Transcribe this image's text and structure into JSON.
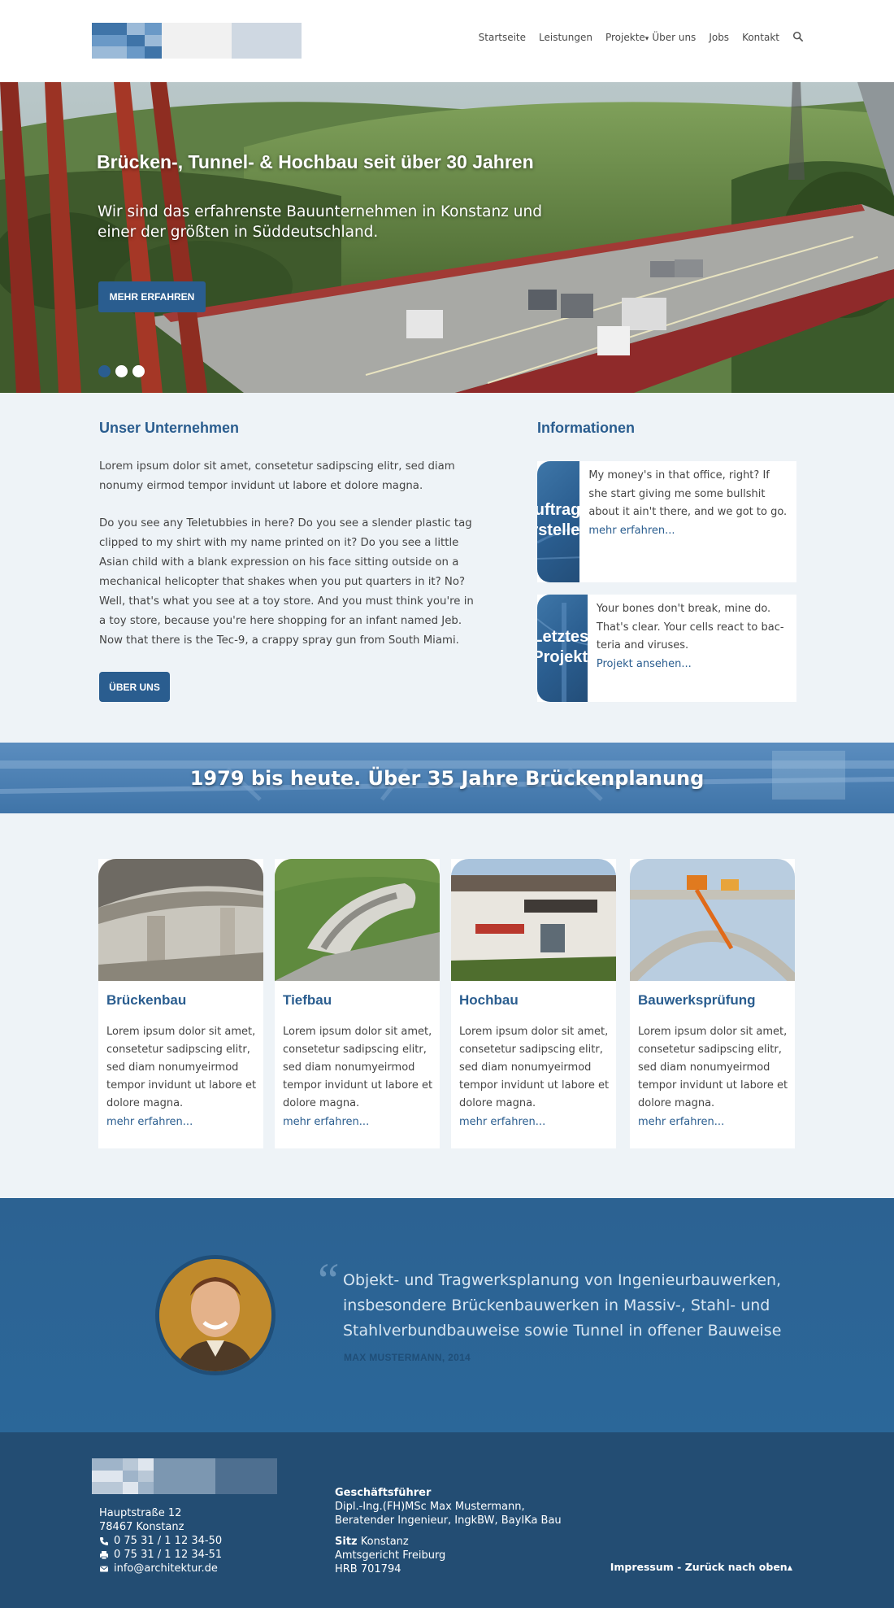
{
  "header": {
    "nav": [
      {
        "label": "Startseite"
      },
      {
        "label": "Leistungen"
      },
      {
        "label": "Projekte"
      },
      {
        "label": "Über uns"
      },
      {
        "label": "Jobs"
      },
      {
        "label": "Kontakt"
      }
    ],
    "projekte_caret": "▾"
  },
  "hero": {
    "title": "Brücken-, Tunnel- & Hochbau seit über 30 Jahren",
    "subtitle": "Wir sind das erfahrenste Bauunternehmen in Konstanz und einer der größten in Süddeutschland.",
    "button": "MEHR ERFAHREN",
    "slides": 3,
    "active_slide": 1
  },
  "company": {
    "title": "Unser Unternehmen",
    "para1": "Lorem ipsum dolor sit amet, consetetur sadipscing elitr, sed diam nonumy eirmod tempor invidunt ut labore et dolore magna.",
    "para2": "Do you see any Teletubbies in here? Do you see a slender plastic tag clipped to my shirt with my name printed on it? Do you see a little Asian child with a blank expression on his face sitting outside on a mechanical helicopter that shakes when you put quarters in it? No? Well, that's what you see at a toy store. And you must think you're in a toy store, because you're here shopping for an infant named Jeb. Now that there is the Tec-9, a crappy spray gun from South Miami.",
    "button": "ÜBER UNS"
  },
  "info": {
    "title": "Informationen",
    "cards": [
      {
        "img_label_1": "Auftrag",
        "img_label_2": "erstellen",
        "text": "My money's in that office, right? If she start giving me some bullshit about it ain't there, and we got to go.",
        "link": "mehr erfahren..."
      },
      {
        "img_label_1": "Letztes",
        "img_label_2": "Projekt",
        "text": "Your bones don't break, mine do. That's clear. Your cells react to bac-teria and viruses.",
        "link": "Projekt ansehen..."
      }
    ],
    "arrow": "▸"
  },
  "banner": {
    "text": "1979 bis heute. Über 35 Jahre Brückenplanung"
  },
  "services": [
    {
      "title": "Brückenbau",
      "text": "Lorem ipsum dolor sit amet, consetetur sadipscing elitr, sed diam nonumyeirmod tempor invidunt ut labore et dolore magna.",
      "link": "mehr erfahren..."
    },
    {
      "title": "Tiefbau",
      "text": "Lorem ipsum dolor sit amet, consetetur sadipscing elitr, sed diam nonumyeirmod tempor invidunt ut labore et dolore magna.",
      "link": "mehr erfahren..."
    },
    {
      "title": "Hochbau",
      "text": "Lorem ipsum dolor sit amet, consetetur sadipscing elitr, sed diam nonumyeirmod tempor invidunt ut labore et dolore magna.",
      "link": "mehr erfahren..."
    },
    {
      "title": "Bauwerksprüfung",
      "text": "Lorem ipsum dolor sit amet, consetetur sadipscing elitr, sed diam nonumyeirmod tempor invidunt ut labore et dolore magna.",
      "link": "mehr erfahren..."
    }
  ],
  "quote": {
    "mark": "“",
    "text": "Objekt- und Tragwerksplanung von Ingenieurbauwerken, insbesondere Brückenbauwerken in Massiv-, Stahl- und Stahlverbundbauweise sowie Tunnel in offener Bauweise",
    "author": "MAX MUSTERMANN, 2014"
  },
  "footer": {
    "street": "Hauptstraße 12",
    "city": "78467 Konstanz",
    "phone": "0 75 31 / 1 12 34-50",
    "fax": "0 75 31 / 1 12 34-51",
    "email": "info@architektur.de",
    "gf_label": "Geschäftsführer",
    "gf_line1": "Dipl.-Ing.(FH)MSc Max Mustermann,",
    "gf_line2": "Beratender Ingenieur, IngkBW, BayIKa Bau",
    "sitz_label": "Sitz",
    "sitz_value": "Konstanz",
    "court": "Amtsgericht Freiburg",
    "hrb": "HRB 701794",
    "impressum": "Impressum",
    "separator": "-",
    "back_to_top": "Zurück nach oben",
    "up_arrow": "▴"
  },
  "colors": {
    "primary": "#2a5d8f",
    "footer_bg": "#234d73",
    "page_bg": "#eef3f7"
  }
}
